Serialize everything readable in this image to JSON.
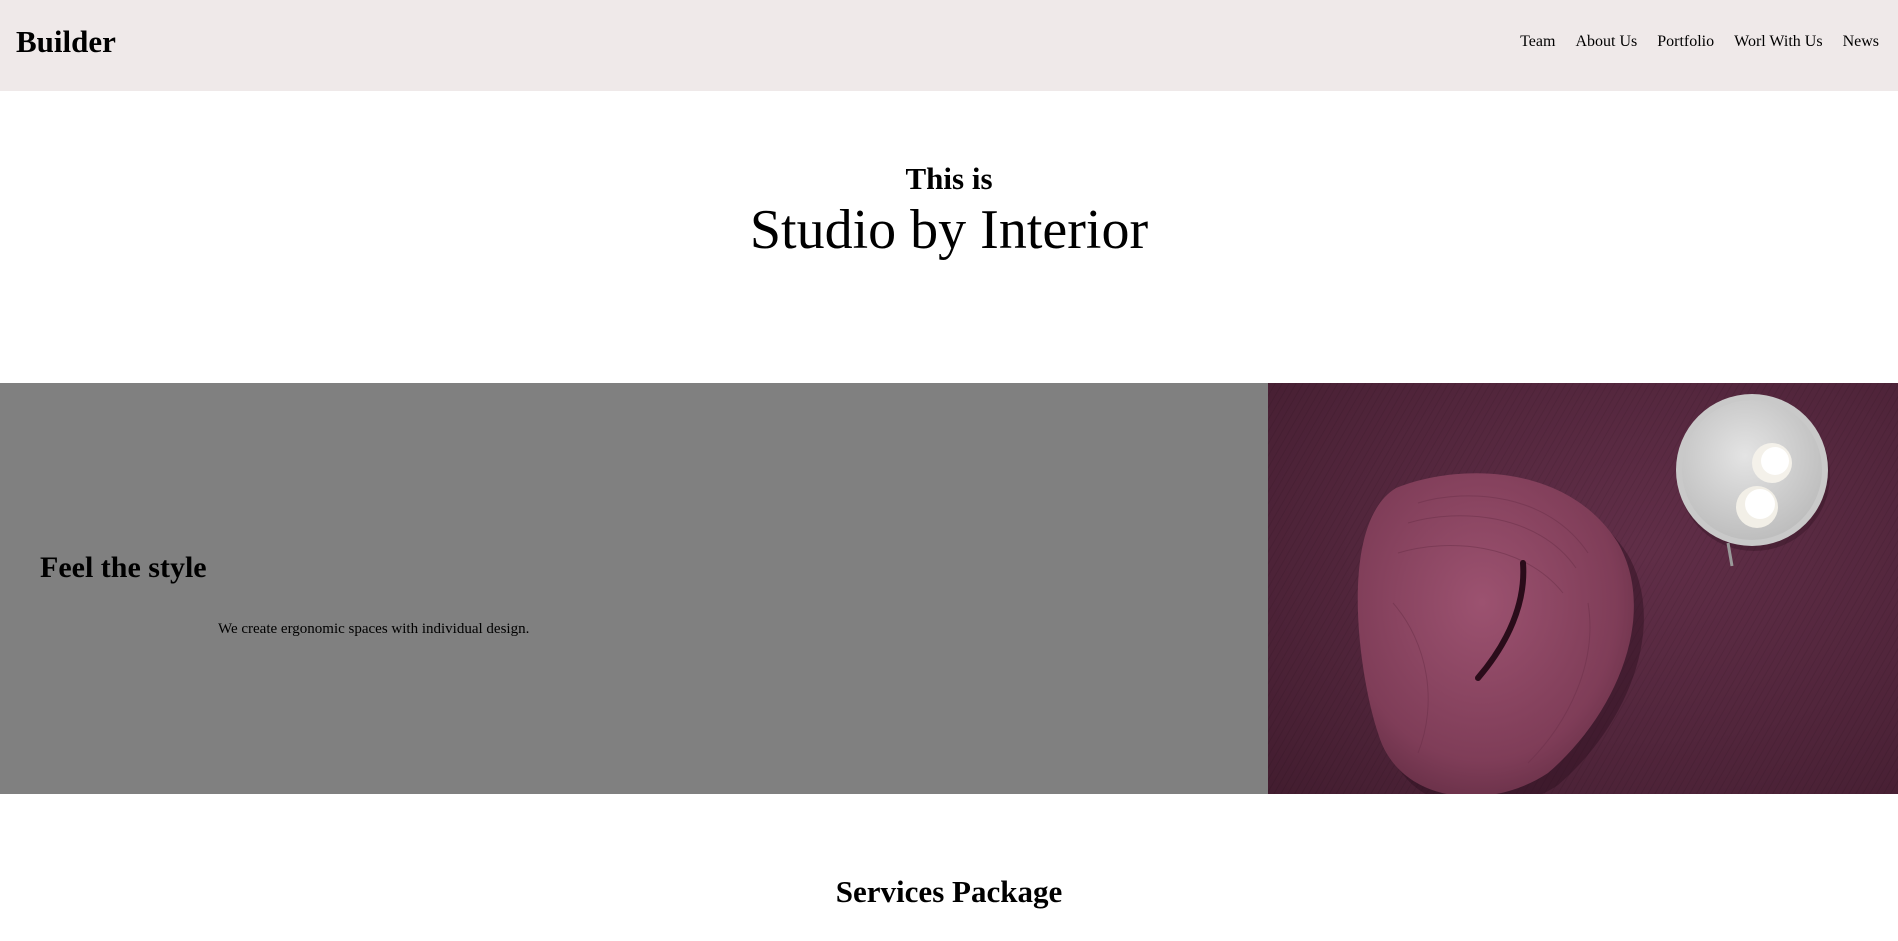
{
  "header": {
    "brand": "Builder",
    "nav": [
      "Team",
      "About Us",
      "Portfolio",
      "Worl With Us",
      "News"
    ]
  },
  "hero": {
    "kicker": "This is",
    "title": "Studio by Interior"
  },
  "feature": {
    "heading": "Feel the style",
    "description": "We create ergonomic spaces with individual design.",
    "image_alt": "armchair-with-side-table-photo"
  },
  "services": {
    "title": "Services Package"
  },
  "colors": {
    "header_bg": "#efe9e9",
    "feature_bg": "#808080",
    "image_bg": "#5a2a42",
    "chair": "#8a4560",
    "table_top": "#d8d8d8"
  }
}
